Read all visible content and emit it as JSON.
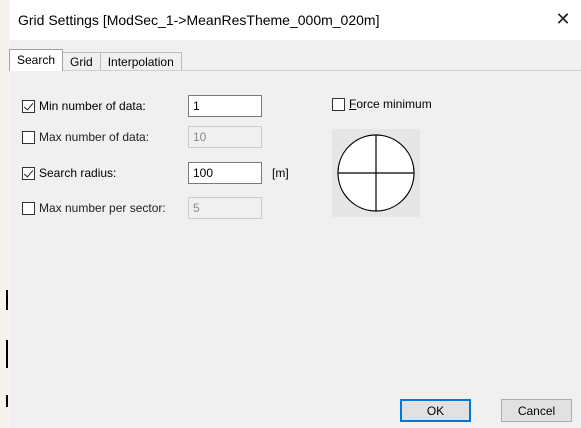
{
  "window": {
    "title": "Grid Settings [ModSec_1->MeanResTheme_000m_020m]",
    "close_glyph": "✕"
  },
  "tabs": [
    {
      "label": "Search",
      "active": true
    },
    {
      "label": "Grid",
      "active": false
    },
    {
      "label": "Interpolation",
      "active": false
    }
  ],
  "search": {
    "min_data": {
      "label": "Min number of data:",
      "checked": true,
      "value": "1",
      "enabled": true
    },
    "max_data": {
      "label": "Max number of data:",
      "checked": false,
      "value": "10",
      "enabled": false
    },
    "radius": {
      "label": "Search radius:",
      "checked": true,
      "value": "100",
      "enabled": true,
      "unit": "[m]"
    },
    "max_sector": {
      "label": "Max number per sector:",
      "checked": false,
      "value": "5",
      "enabled": false
    },
    "force_minimum": {
      "label_mnemonic": "F",
      "label_rest": "orce minimum",
      "checked": false
    }
  },
  "buttons": {
    "ok_label": "OK",
    "cancel_label": "Cancel"
  },
  "colors": {
    "dialog_bg": "#f0f0f0",
    "accent": "#0078d7"
  },
  "icons": {
    "sector_diagram": "circle-divided-into-quadrants",
    "close": "close-icon"
  }
}
